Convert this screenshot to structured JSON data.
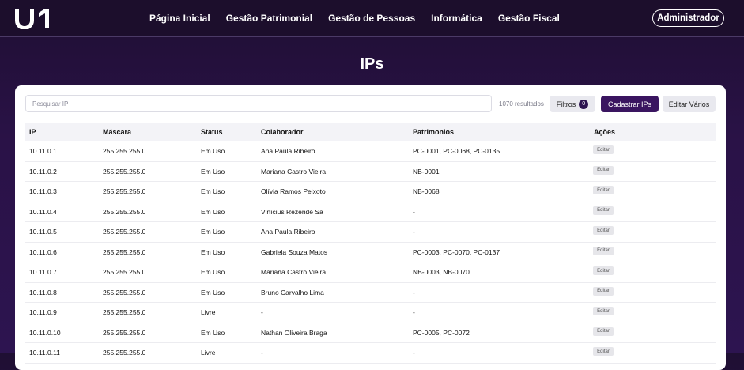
{
  "header": {
    "logo_text": "U1",
    "nav": [
      "Página Inicial",
      "Gestão Patrimonial",
      "Gestão de Pessoas",
      "Informática",
      "Gestão Fiscal"
    ],
    "user_button": "Administrador"
  },
  "page": {
    "title": "IPs"
  },
  "toolbar": {
    "search_placeholder": "Pesquisar IP",
    "results": "1070 resultados",
    "filters_label": "Filtros",
    "filters_count": "0",
    "create_label": "Cadastrar IPs",
    "bulk_edit_label": "Editar Vários"
  },
  "table": {
    "columns": [
      "IP",
      "Máscara",
      "Status",
      "Colaborador",
      "Patrimonios",
      "Ações"
    ],
    "edit_label": "Editar",
    "rows": [
      [
        "10.11.0.1",
        "255.255.255.0",
        "Em Uso",
        "Ana Paula Ribeiro",
        "PC-0001, PC-0068, PC-0135"
      ],
      [
        "10.11.0.2",
        "255.255.255.0",
        "Em Uso",
        "Mariana Castro Vieira",
        "NB-0001"
      ],
      [
        "10.11.0.3",
        "255.255.255.0",
        "Em Uso",
        "Olívia Ramos Peixoto",
        "NB-0068"
      ],
      [
        "10.11.0.4",
        "255.255.255.0",
        "Em Uso",
        "Vinícius Rezende Sá",
        "-"
      ],
      [
        "10.11.0.5",
        "255.255.255.0",
        "Em Uso",
        "Ana Paula Ribeiro",
        "-"
      ],
      [
        "10.11.0.6",
        "255.255.255.0",
        "Em Uso",
        "Gabriela Souza Matos",
        "PC-0003, PC-0070, PC-0137"
      ],
      [
        "10.11.0.7",
        "255.255.255.0",
        "Em Uso",
        "Mariana Castro Vieira",
        "NB-0003, NB-0070"
      ],
      [
        "10.11.0.8",
        "255.255.255.0",
        "Em Uso",
        "Bruno Carvalho Lima",
        "-"
      ],
      [
        "10.11.0.9",
        "255.255.255.0",
        "Livre",
        "-",
        "-"
      ],
      [
        "10.11.0.10",
        "255.255.255.0",
        "Em Uso",
        "Nathan Oliveira Braga",
        "PC-0005, PC-0072"
      ],
      [
        "10.11.0.11",
        "255.255.255.0",
        "Livre",
        "-",
        "-"
      ]
    ]
  },
  "colors": {
    "background": "#2a1247",
    "header": "#1c0e2c",
    "primary": "#3a1560"
  }
}
